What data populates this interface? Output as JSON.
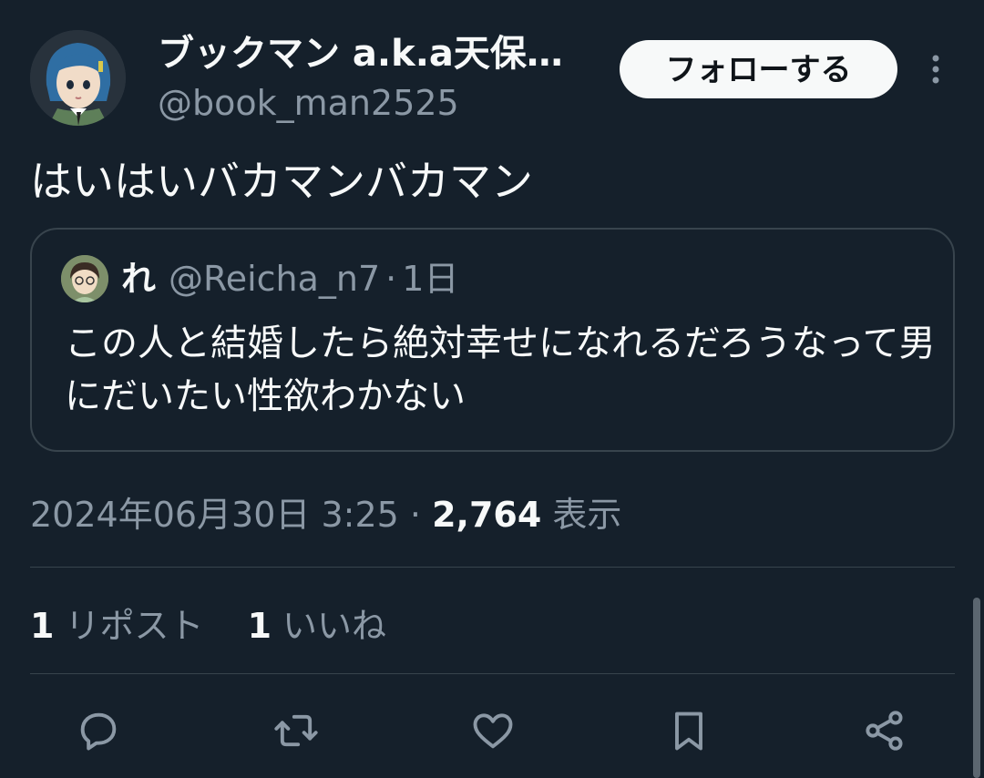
{
  "author": {
    "display_name": "ブックマン a.k.a天保…",
    "handle": "@book_man2525"
  },
  "follow_button": "フォローする",
  "tweet": {
    "text": "はいはいバカマンバカマン"
  },
  "quoted_tweet": {
    "name": "れ",
    "handle": "@Reicha_n7",
    "separator": "·",
    "time": "1日",
    "text": "この人と結婚したら絶対幸せになれるだろうなって男にだいたい性欲わかない"
  },
  "meta": {
    "datetime": "2024年06月30日 3:25",
    "separator": "·",
    "views_count": "2,764",
    "views_label": "表示"
  },
  "stats": {
    "reposts_count": "1",
    "reposts_label": "リポスト",
    "likes_count": "1",
    "likes_label": "いいね"
  },
  "actions": [
    "reply-icon",
    "repost-icon",
    "like-icon",
    "bookmark-icon",
    "share-icon"
  ],
  "colors": {
    "background": "#15202b",
    "text": "#f7f9f9",
    "secondary": "#8b98a5",
    "border": "#38444d"
  }
}
